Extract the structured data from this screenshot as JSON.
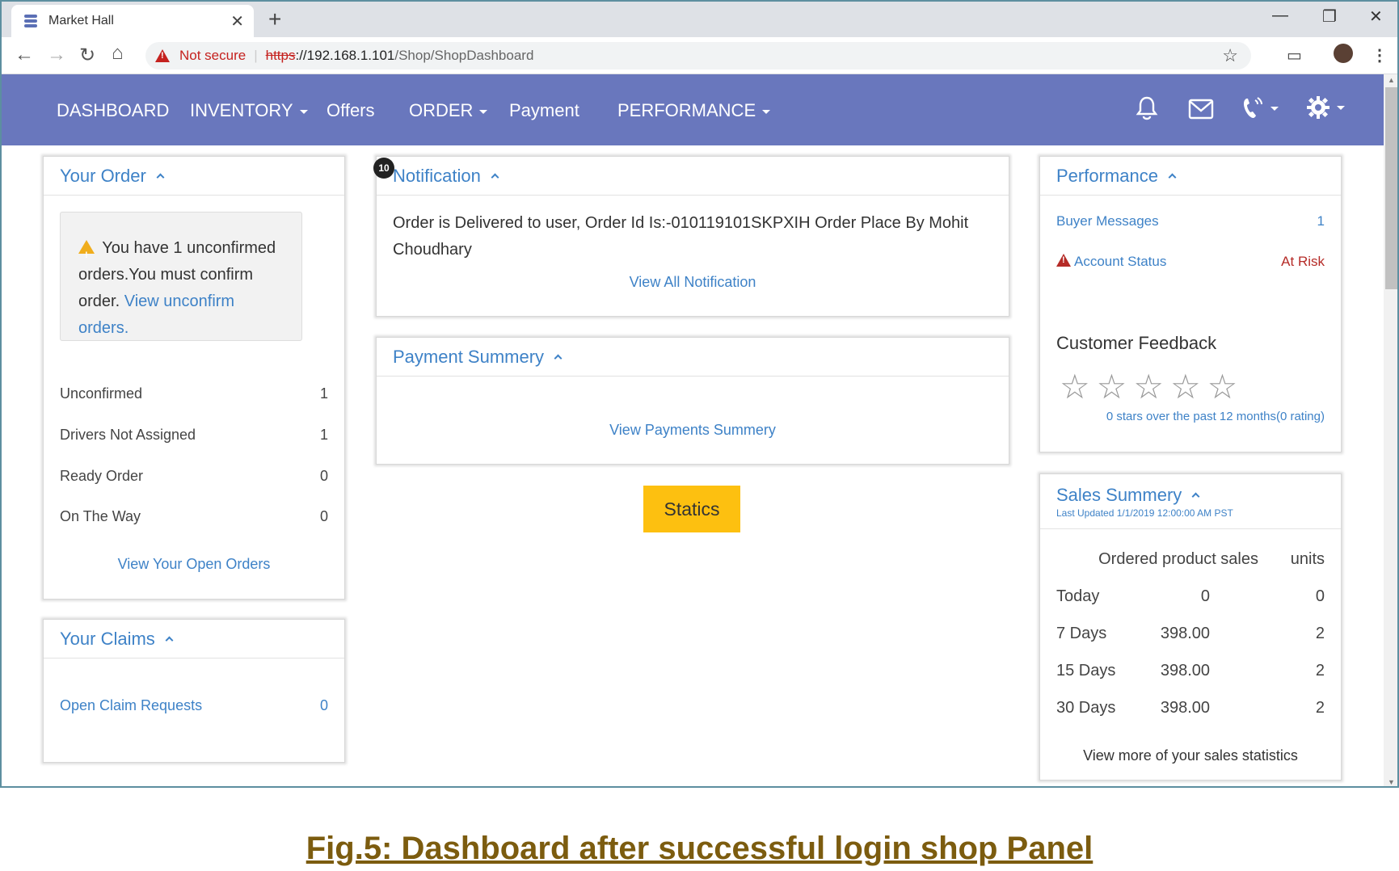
{
  "browser": {
    "tab_title": "Market Hall",
    "tab_close": "✕",
    "new_tab": "+",
    "security_label": "Not secure",
    "url_scheme": "https",
    "url_host": "://192.168.1.101",
    "url_path": "/Shop/ShopDashboard",
    "win_minimize": "—",
    "win_restore": "❐",
    "win_close": "✕",
    "icons": [
      "back-arrow-icon",
      "forward-arrow-icon",
      "reload-icon",
      "home-icon",
      "star-icon",
      "cast-icon",
      "menu-dots-icon"
    ]
  },
  "nav": {
    "dashboard": "DASHBOARD",
    "inventory": "INVENTORY",
    "offers": "Offers",
    "order": "ORDER",
    "payment": "Payment",
    "performance": "PERFORMANCE",
    "icons": [
      "bell-icon",
      "envelope-icon",
      "phone-icon",
      "gear-icon"
    ],
    "bg_color": "#6977bd"
  },
  "your_order": {
    "title": "Your Order",
    "alert_text": "You have 1 unconfirmed orders.You must confirm order.",
    "alert_link": "View unconfirm orders.",
    "rows": [
      {
        "label": "Unconfirmed",
        "value": "1"
      },
      {
        "label": "Drivers Not Assigned",
        "value": "1"
      },
      {
        "label": "Ready Order",
        "value": "0"
      },
      {
        "label": "On The Way",
        "value": "0"
      }
    ],
    "footer_link": "View Your Open Orders"
  },
  "your_claims": {
    "title": "Your Claims",
    "row_label": "Open Claim Requests",
    "row_value": "0"
  },
  "notification": {
    "badge": "10",
    "title": "Notification",
    "message": "Order is Delivered to user, Order Id Is:-010119101SKPXIH Order Place By Mohit Choudhary",
    "view_all": "View All Notification"
  },
  "payment_summary": {
    "title": "Payment Summery",
    "link": "View Payments Summery"
  },
  "statics_button": "Statics",
  "performance": {
    "title": "Performance",
    "buyer_messages_label": "Buyer Messages",
    "buyer_messages_value": "1",
    "account_status_label": "Account Status",
    "account_status_value": "At Risk",
    "feedback_title": "Customer Feedback",
    "rating_stars": 0,
    "stars_max": 5,
    "rating_text": "0 stars over the past 12 months(0 rating)"
  },
  "sales_summary": {
    "title": "Sales Summery",
    "last_updated": "Last Updated 1/1/2019 12:00:00 AM PST",
    "col_sales": "Ordered product sales",
    "col_units": "units",
    "rows": [
      {
        "period": "Today",
        "sales": "0",
        "units": "0"
      },
      {
        "period": "7 Days",
        "sales": "398.00",
        "units": "2"
      },
      {
        "period": "15 Days",
        "sales": "398.00",
        "units": "2"
      },
      {
        "period": "30 Days",
        "sales": "398.00",
        "units": "2"
      }
    ],
    "footer_link": "View more of your sales statistics"
  },
  "caption": "Fig.5: Dashboard after successful login shop Panel",
  "colors": {
    "link": "#3e82c7",
    "danger": "#b52b27",
    "warning": "#f0ad1c",
    "button": "#fdc010",
    "caption": "#7c5c0f"
  }
}
